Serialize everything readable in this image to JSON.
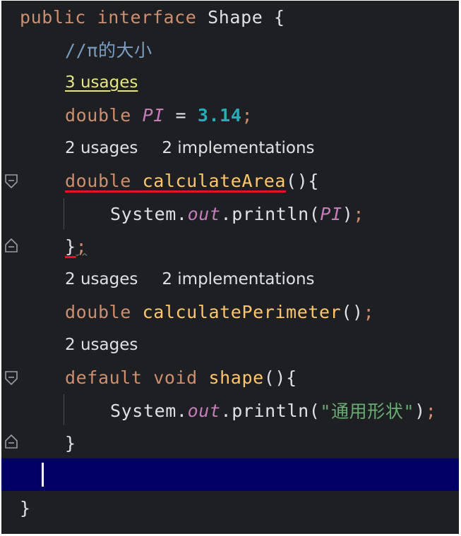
{
  "code": {
    "l1": {
      "kw1": "public",
      "kw2": "interface",
      "name": "Shape",
      "brace": "{"
    },
    "l2": {
      "comment": "//π的大小"
    },
    "l3": {
      "hint": "3 usages"
    },
    "l4": {
      "type": "double",
      "name": "PI",
      "eq": "=",
      "value": "3.14",
      "semi": ";"
    },
    "l5": {
      "usages": "2 usages",
      "impl": "2 implementations"
    },
    "l6": {
      "type": "double",
      "name": "calculateArea",
      "parens": "()",
      "brace": "{"
    },
    "l7": {
      "obj": "System",
      "dot1": ".",
      "field": "out",
      "dot2": ".",
      "method": "println",
      "open": "(",
      "arg": "PI",
      "close": ")",
      "semi": ";"
    },
    "l8": {
      "brace": "}",
      "semi": ";"
    },
    "l9": {
      "usages": "2 usages",
      "impl": "2 implementations"
    },
    "l10": {
      "type": "double",
      "name": "calculatePerimeter",
      "parens": "()",
      "semi": ";"
    },
    "l11": {
      "usages": "2 usages"
    },
    "l12": {
      "kw1": "default",
      "kw2": "void",
      "name": "shape",
      "parens": "()",
      "brace": "{"
    },
    "l13": {
      "obj": "System",
      "dot1": ".",
      "field": "out",
      "dot2": ".",
      "method": "println",
      "open": "(",
      "arg": "\"通用形状\"",
      "close": ")",
      "semi": ";"
    },
    "l14": {
      "brace": "}"
    },
    "l16": {
      "brace": "}"
    }
  },
  "colors": {
    "background": "#1e1f22",
    "current_line": "#000066",
    "keyword": "#cf8e6d",
    "method": "#ffc66d",
    "constant": "#c77dbb",
    "number": "#2aacb8",
    "string": "#6aab73",
    "comment": "#7a9ec2",
    "error_underline": "#e81123"
  },
  "icons": {
    "fold": "fold-marker-icon"
  }
}
